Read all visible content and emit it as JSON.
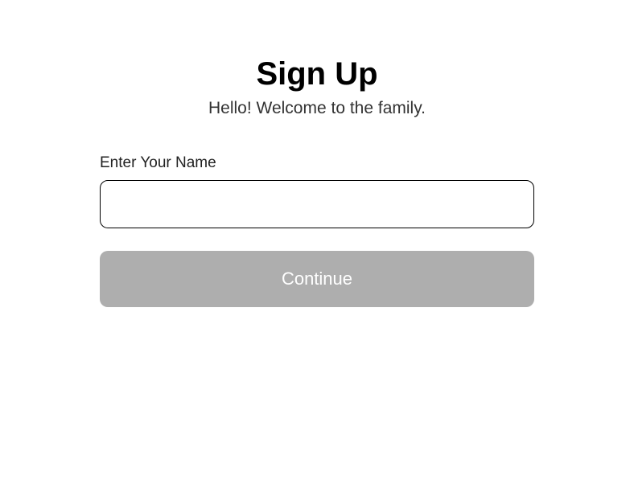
{
  "header": {
    "title": "Sign Up",
    "subtitle": "Hello! Welcome to the family."
  },
  "form": {
    "name_label": "Enter Your Name",
    "name_value": "",
    "name_placeholder": ""
  },
  "actions": {
    "continue_label": "Continue"
  }
}
